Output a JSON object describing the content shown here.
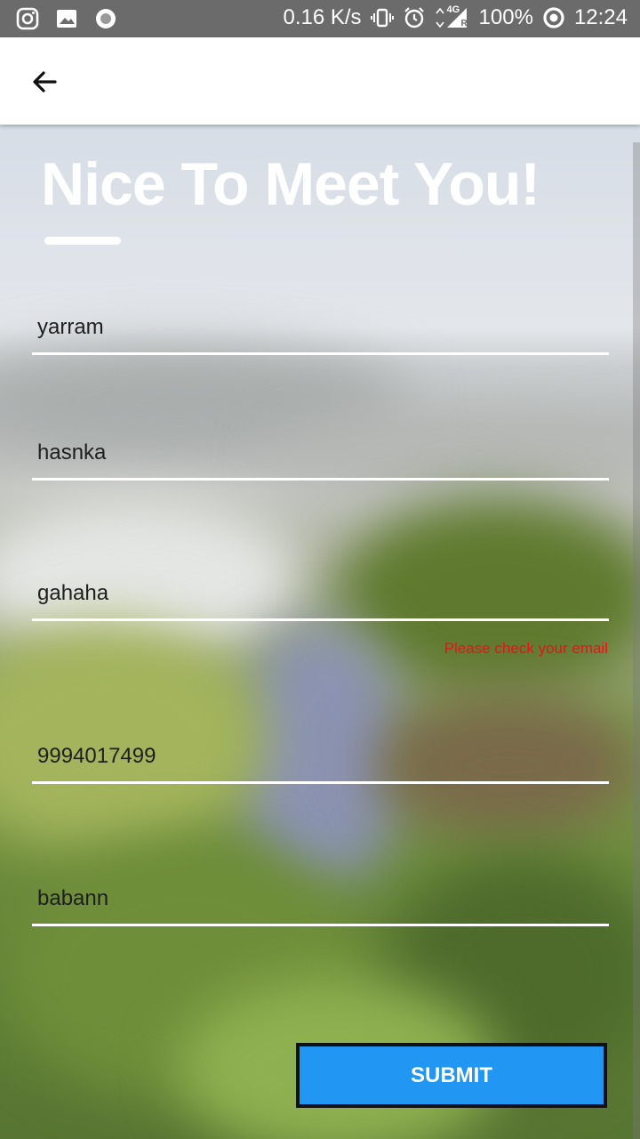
{
  "status_bar": {
    "network_speed": "0.16 K/s",
    "network_type": "4G",
    "roaming": "R",
    "battery": "100%",
    "time": "12:24",
    "icons": [
      "instagram-icon",
      "gallery-icon",
      "record-icon",
      "vibrate-icon",
      "alarm-icon",
      "signal-icon",
      "battery-ring-icon"
    ]
  },
  "app_bar": {
    "back_icon": "arrow-back-icon"
  },
  "form": {
    "title": "Nice To Meet You!",
    "fields": [
      {
        "value": "yarram"
      },
      {
        "value": "hasnka"
      },
      {
        "value": "gahaha"
      },
      {
        "value": "9994017499"
      },
      {
        "value": "babann"
      }
    ],
    "email_error": "Please check your email",
    "submit_label": "SUBMIT"
  },
  "colors": {
    "status_bar": "#6b6b6b",
    "accent_button": "#2196f3",
    "error": "#e8131a"
  }
}
